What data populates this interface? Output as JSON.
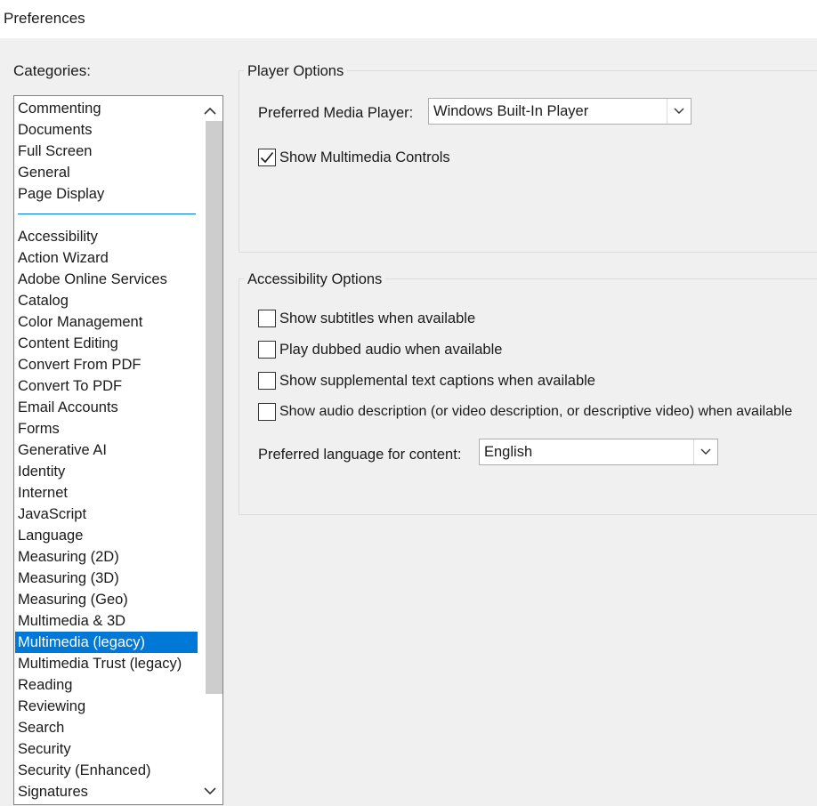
{
  "window": {
    "title": "Preferences"
  },
  "categories": {
    "label": "Categories:",
    "top_items": [
      "Commenting",
      "Documents",
      "Full Screen",
      "General",
      "Page Display"
    ],
    "items": [
      "Accessibility",
      "Action Wizard",
      "Adobe Online Services",
      "Catalog",
      "Color Management",
      "Content Editing",
      "Convert From PDF",
      "Convert To PDF",
      "Email Accounts",
      "Forms",
      "Generative AI",
      "Identity",
      "Internet",
      "JavaScript",
      "Language",
      "Measuring (2D)",
      "Measuring (3D)",
      "Measuring (Geo)",
      "Multimedia & 3D",
      "Multimedia (legacy)",
      "Multimedia Trust (legacy)",
      "Reading",
      "Reviewing",
      "Search",
      "Security",
      "Security (Enhanced)",
      "Signatures"
    ],
    "selected": "Multimedia (legacy)"
  },
  "player_options": {
    "legend": "Player Options",
    "preferred_player_label": "Preferred Media Player:",
    "preferred_player_value": "Windows Built-In Player",
    "show_controls_label": "Show Multimedia Controls",
    "show_controls_checked": true
  },
  "accessibility_options": {
    "legend": "Accessibility Options",
    "checkboxes": [
      {
        "label": "Show subtitles when available",
        "checked": false
      },
      {
        "label": "Play dubbed audio when available",
        "checked": false
      },
      {
        "label": "Show supplemental text captions when available",
        "checked": false
      },
      {
        "label": "Show audio description (or video description, or descriptive video) when available",
        "checked": false
      }
    ],
    "language_label": "Preferred language for content:",
    "language_value": "English"
  },
  "colors": {
    "selection": "#0078d7",
    "background": "#f0f0f0"
  }
}
